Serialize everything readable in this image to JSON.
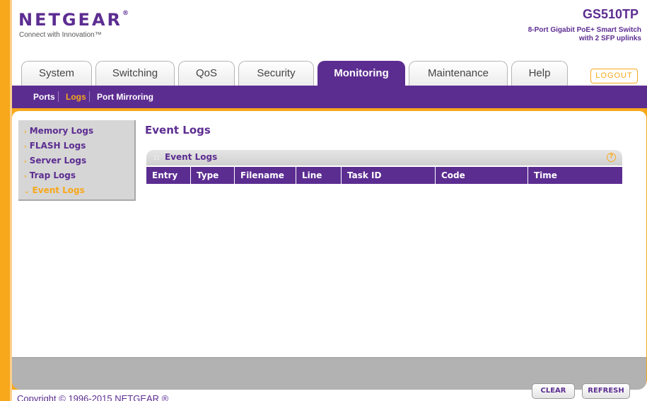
{
  "header": {
    "logo_text": "NETGEAR",
    "logo_mark": "®",
    "tagline": "Connect with Innovation™",
    "model": "GS510TP",
    "model_desc_line1": "8-Port Gigabit PoE+ Smart Switch",
    "model_desc_line2": "with 2 SFP uplinks"
  },
  "tabs": [
    {
      "label": "System"
    },
    {
      "label": "Switching"
    },
    {
      "label": "QoS"
    },
    {
      "label": "Security"
    },
    {
      "label": "Monitoring"
    },
    {
      "label": "Maintenance"
    },
    {
      "label": "Help"
    }
  ],
  "active_tab": "Monitoring",
  "logout_label": "LOGOUT",
  "subnav": [
    {
      "label": "Ports"
    },
    {
      "label": "Logs"
    },
    {
      "label": "Port Mirroring"
    }
  ],
  "active_subnav": "Logs",
  "sidemenu": [
    {
      "label": "Memory Logs"
    },
    {
      "label": "FLASH Logs"
    },
    {
      "label": "Server Logs"
    },
    {
      "label": "Trap Logs"
    },
    {
      "label": "Event Logs"
    }
  ],
  "active_sidemenu": "Event Logs",
  "page_title": "Event Logs",
  "section": {
    "title": "Event Logs",
    "help_icon": "help-icon"
  },
  "table": {
    "columns": [
      "Entry",
      "Type",
      "Filename",
      "Line",
      "Task ID",
      "Code",
      "Time"
    ],
    "rows": []
  },
  "buttons": {
    "clear": "CLEAR",
    "refresh": "REFRESH"
  },
  "footer": {
    "copyright": "Copyright © 1996-2015 NETGEAR ®"
  },
  "colors": {
    "brand_purple": "#5c2d91",
    "brand_orange": "#f7a81b"
  }
}
